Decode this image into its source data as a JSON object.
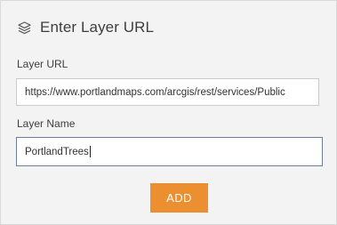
{
  "header": {
    "title": "Enter Layer URL",
    "icon": "layers-icon"
  },
  "form": {
    "url_label": "Layer URL",
    "url_value": "https://www.portlandmaps.com/arcgis/rest/services/Public",
    "name_label": "Layer Name",
    "name_value": "PortlandTrees"
  },
  "actions": {
    "add_label": "ADD"
  },
  "colors": {
    "accent": "#eb8f30",
    "panel_bg": "#f3f3f3",
    "active_border": "#6a7f9a"
  }
}
